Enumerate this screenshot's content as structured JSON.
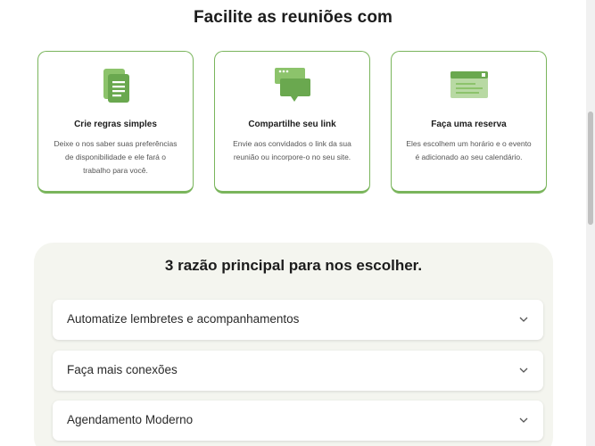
{
  "hero": {
    "title": "Facilite as reuniões com"
  },
  "cards": [
    {
      "icon": "document-icon",
      "title": "Crie regras simples",
      "desc": "Deixe o nos saber suas preferências de disponibilidade e ele fará o trabalho para você."
    },
    {
      "icon": "chat-icon",
      "title": "Compartilhe seu link",
      "desc": "Envie aos convidados o link da sua reunião ou incorpore-o no seu site."
    },
    {
      "icon": "calendar-window-icon",
      "title": "Faça uma reserva",
      "desc": "Eles escolhem um horário e o evento é adicionado ao seu calendário."
    }
  ],
  "reasons": {
    "title": "3 razão principal para nos escolher.",
    "items": [
      {
        "label": "Automatize lembretes e acompanhamentos"
      },
      {
        "label": "Faça mais conexões"
      },
      {
        "label": "Agendamento Moderno"
      }
    ]
  },
  "colors": {
    "accent": "#7ab55c",
    "panel": "#f4f5ef"
  }
}
